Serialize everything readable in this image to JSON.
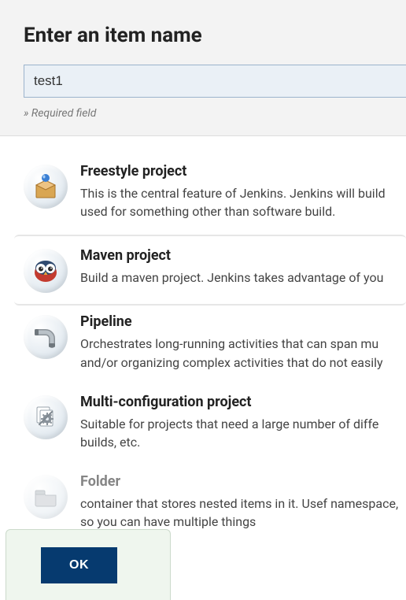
{
  "header": {
    "title": "Enter an item name",
    "item_name_value": "test1",
    "required_note": "» Required field"
  },
  "items": [
    {
      "key": "freestyle",
      "title": "Freestyle project",
      "desc": "This is the central feature of Jenkins. Jenkins will build used for something other than software build.",
      "selected": false
    },
    {
      "key": "maven",
      "title": "Maven project",
      "desc": "Build a maven project. Jenkins takes advantage of you",
      "selected": true
    },
    {
      "key": "pipeline",
      "title": "Pipeline",
      "desc": "Orchestrates long-running activities that can span mu and/or organizing complex activities that do not easily",
      "selected": false
    },
    {
      "key": "multiconfig",
      "title": "Multi-configuration project",
      "desc": "Suitable for projects that need a large number of diffe builds, etc.",
      "selected": false
    },
    {
      "key": "folder",
      "title": "Folder",
      "desc": "container that stores nested items in it. Usef namespace, so you can have multiple things",
      "selected": false
    }
  ],
  "footer": {
    "ok_label": "OK"
  },
  "icons": {
    "freestyle": "package-icon",
    "maven": "owl-icon",
    "pipeline": "pipe-icon",
    "multiconfig": "files-gear-icon",
    "folder": "folder-icon"
  }
}
